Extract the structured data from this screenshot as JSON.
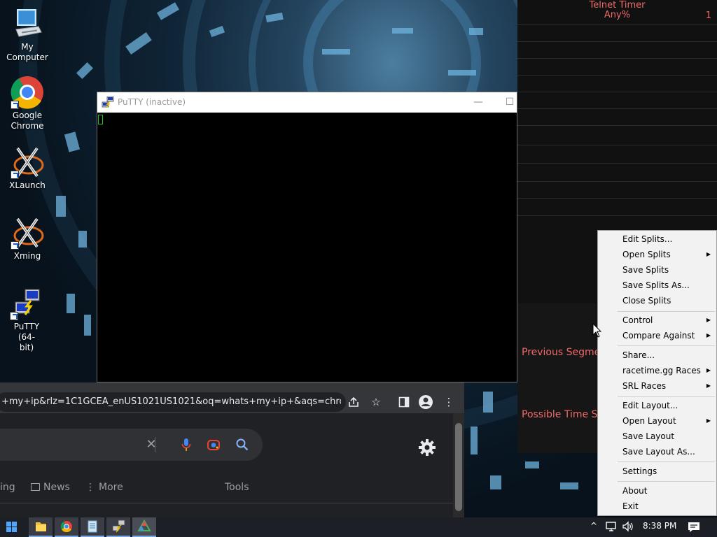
{
  "desktop": {
    "icons": [
      {
        "label": "My Computer",
        "icon": "computer-icon"
      },
      {
        "label": "Google Chrome",
        "icon": "chrome-icon"
      },
      {
        "label": "XLaunch",
        "icon": "xlaunch-icon"
      },
      {
        "label": "Xming",
        "icon": "xming-icon"
      },
      {
        "label": "PuTTY (64-bit)",
        "icon": "putty-icon"
      }
    ]
  },
  "timer": {
    "title": "Telnet Timer",
    "category": "Any%",
    "attempts": "1",
    "previous_segment_label": "Previous Segment",
    "possible_time_save_label": "Possible Time Save",
    "text_color": "#f06a6a"
  },
  "putty": {
    "title": "PuTTY (inactive)",
    "minimize": "—",
    "maximize": "☐"
  },
  "chrome": {
    "url": "+my+ip&rlz=1C1GCEA_enUS1021US1021&oq=whats+my+ip+&aqs=chrome...",
    "tabs": {
      "partial": "ing",
      "news": "News",
      "more": "More",
      "tools": "Tools"
    }
  },
  "context_menu": {
    "items": [
      {
        "label": "Edit Splits...",
        "submenu": false
      },
      {
        "label": "Open Splits",
        "submenu": true
      },
      {
        "label": "Save Splits",
        "submenu": false
      },
      {
        "label": "Save Splits As...",
        "submenu": false
      },
      {
        "label": "Close Splits",
        "submenu": false
      },
      {
        "label": "Control",
        "submenu": true
      },
      {
        "label": "Compare Against",
        "submenu": true
      },
      {
        "label": "Share...",
        "submenu": false
      },
      {
        "label": "racetime.gg Races",
        "submenu": true
      },
      {
        "label": "SRL Races",
        "submenu": true
      },
      {
        "label": "Edit Layout...",
        "submenu": false
      },
      {
        "label": "Open Layout",
        "submenu": true
      },
      {
        "label": "Save Layout",
        "submenu": false
      },
      {
        "label": "Save Layout As...",
        "submenu": false
      },
      {
        "label": "Settings",
        "submenu": false
      },
      {
        "label": "About",
        "submenu": false
      },
      {
        "label": "Exit",
        "submenu": false
      }
    ]
  },
  "taskbar": {
    "time": "8:38 PM",
    "apps": [
      "start-icon",
      "file-explorer-icon",
      "chrome-icon",
      "notepad-icon",
      "putty-icon",
      "livesplit-icon"
    ]
  }
}
